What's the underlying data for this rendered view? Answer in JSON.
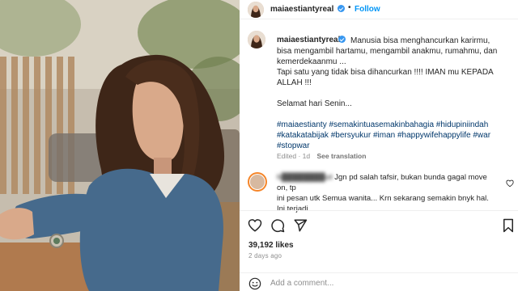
{
  "post": {
    "username": "maiaestiantyreal",
    "follow_label": "Follow",
    "separator": "•"
  },
  "caption": {
    "username": "maiaestiantyreal",
    "line1": "Manusia bisa menghancurkan karirmu,",
    "line2": "bisa mengambil hartamu, mengambil anakmu, rumahmu, dan",
    "line3": "kemerdekaanmu ...",
    "line4": "Tapi satu yang tidak bisa dihancurkan !!!! IMAN mu KEPADA",
    "line5": "ALLAH !!!",
    "line6": "Selamat hari Senin...",
    "hashtags_line1": "#maiaestianty #semakintuasemakinbahagia #hidupiniindah",
    "hashtags_line2": "#katakatabijak #bersyukur #iman #happywifehappylife #war",
    "hashtags_line3": "#stopwar",
    "edited": "Edited · 1d",
    "see_translation": "See translation"
  },
  "comment": {
    "username": "h████████ut",
    "text_line1": "Jgn pd salah tafsir, bukan bunda gagal move on, tp",
    "text_line2": "ini pesan utk Semua wanita... Krn sekarang semakin bnyk hal.",
    "text_line3": "Ini terjadi"
  },
  "stats": {
    "likes": "39,192 likes",
    "time_ago": "2 days ago"
  },
  "add_comment": {
    "placeholder": "Add a comment..."
  },
  "icons": {
    "like": "heart-icon",
    "comment": "comment-icon",
    "share": "share-icon",
    "save": "bookmark-icon",
    "emoji": "emoji-icon",
    "verified": "verified-badge-icon"
  },
  "colors": {
    "link_blue": "#0095f6",
    "hashtag": "#00376b",
    "muted": "#8e8e8e",
    "verified": "#3897f0"
  }
}
